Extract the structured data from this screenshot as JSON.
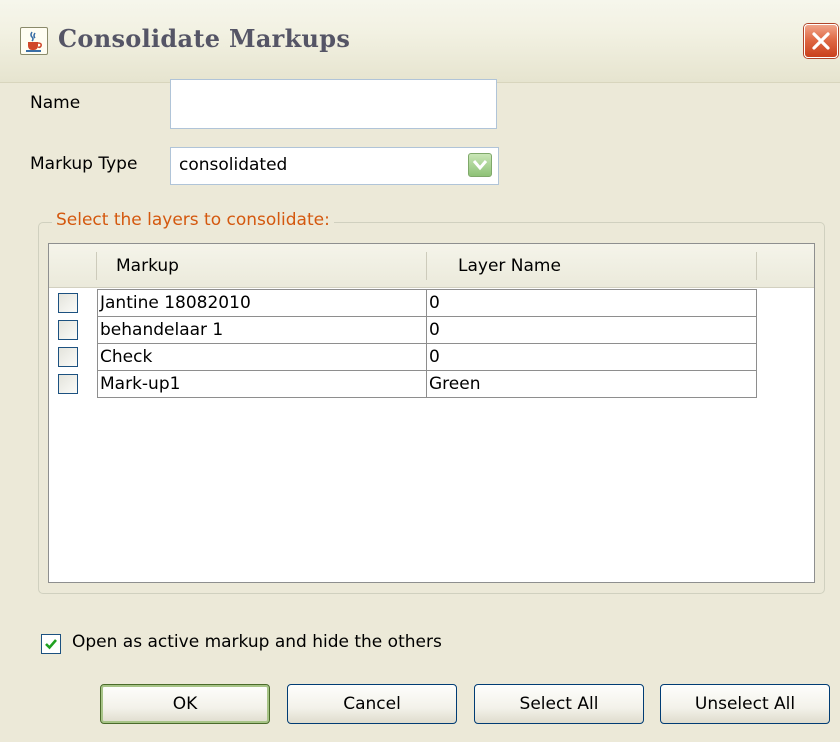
{
  "window": {
    "title": "Consolidate Markups",
    "icon": "java-cup-icon"
  },
  "form": {
    "name_label": "Name",
    "name_value": "",
    "markup_type_label": "Markup Type",
    "markup_type_value": "consolidated"
  },
  "layers": {
    "legend": "Select the layers to consolidate:",
    "columns": [
      "Markup",
      "Layer Name"
    ],
    "rows": [
      {
        "markup": "Jantine 18082010",
        "layer": "0",
        "checked": false
      },
      {
        "markup": "behandelaar 1",
        "layer": "0",
        "checked": false
      },
      {
        "markup": "Check",
        "layer": "0",
        "checked": false
      },
      {
        "markup": "Mark-up1",
        "layer": "Green",
        "checked": false
      }
    ]
  },
  "options": {
    "open_active_label": "Open as active markup and hide the others",
    "open_active_checked": true
  },
  "buttons": {
    "ok": "OK",
    "cancel": "Cancel",
    "select_all": "Select All",
    "unselect_all": "Unselect All"
  },
  "colors": {
    "legend_text": "#d4580e",
    "checkbox_border": "#1c5180",
    "checkmark": "#21a121",
    "close_button": "#e06a46"
  }
}
